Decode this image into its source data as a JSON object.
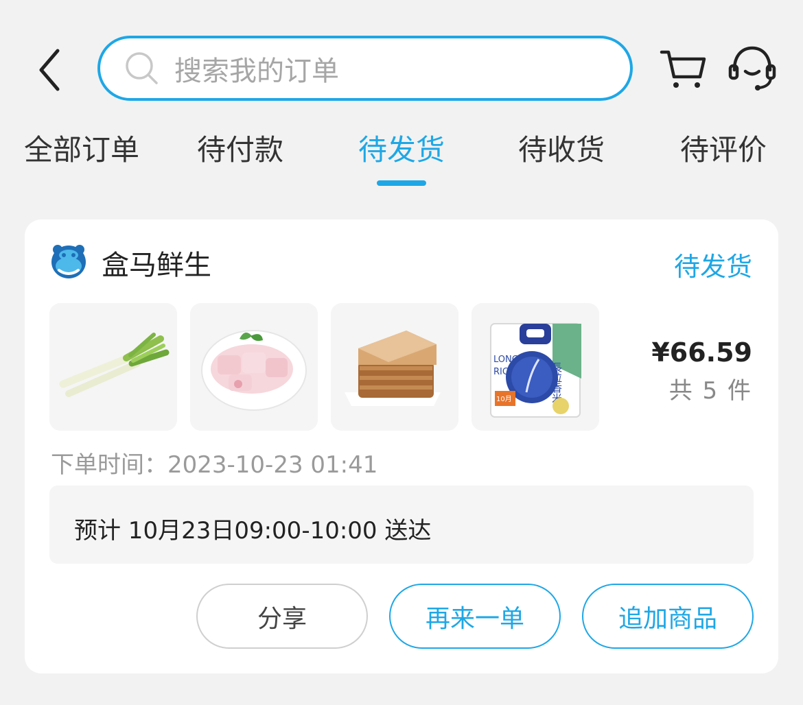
{
  "header": {
    "search_placeholder": "搜索我的订单"
  },
  "tabs": [
    {
      "label": "全部订单",
      "active": false
    },
    {
      "label": "待付款",
      "active": false
    },
    {
      "label": "待发货",
      "active": true
    },
    {
      "label": "待收货",
      "active": false
    },
    {
      "label": "待评价",
      "active": false
    }
  ],
  "order": {
    "store_name": "盒马鲜生",
    "status": "待发货",
    "products": [
      {
        "icon": "green-onion-image"
      },
      {
        "icon": "pork-image"
      },
      {
        "icon": "toast-bread-image"
      },
      {
        "icon": "rice-bag-image",
        "text": [
          "LONG",
          "RIC",
          "長粒香米",
          "10月"
        ]
      }
    ],
    "price": "¥66.59",
    "count": "共 5 件",
    "order_time_label": "下单时间：",
    "order_time": "2023-10-23 01:41",
    "delivery": "预计 10月23日09:00-10:00 送达",
    "buttons": {
      "share": "分享",
      "reorder": "再来一单",
      "add": "追加商品"
    }
  },
  "colors": {
    "accent": "#1ea7e6",
    "background": "#f2f2f2"
  }
}
